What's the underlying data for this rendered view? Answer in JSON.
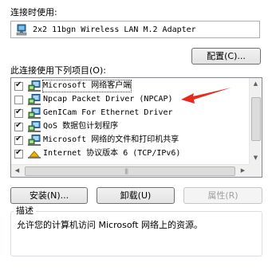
{
  "connect_using": {
    "label": "连接时使用:",
    "adapter_name": "2x2 11bgn Wireless LAN M.2 Adapter",
    "adapter_icon": "network-card-icon"
  },
  "configure_button": {
    "label": "配置(C)..."
  },
  "components": {
    "label": "此连接使用下列项目(O):",
    "items": [
      {
        "label": "Microsoft 网络客户端",
        "checked": true,
        "icon": "network-client-icon"
      },
      {
        "label": "Npcap Packet Driver (NPCAP)",
        "checked": false,
        "icon": "network-client-icon"
      },
      {
        "label": "GenICam For Ethernet Driver",
        "checked": true,
        "icon": "network-client-icon"
      },
      {
        "label": "QoS 数据包计划程序",
        "checked": true,
        "icon": "network-client-icon"
      },
      {
        "label": "Microsoft 网络的文件和打印机共享",
        "checked": true,
        "icon": "network-client-icon"
      },
      {
        "label": "Internet 协议版本 6 (TCP/IPv6)",
        "checked": true,
        "icon": "protocol-icon"
      }
    ]
  },
  "annotation": {
    "color": "#e8291c",
    "icon": "red-arrow-icon"
  },
  "buttons": {
    "install": "安装(N)...",
    "uninstall": "卸载(U)",
    "properties": "属性(R)"
  },
  "description": {
    "legend": "描述",
    "text": "允许您的计算机访问 Microsoft 网络上的资源。"
  }
}
